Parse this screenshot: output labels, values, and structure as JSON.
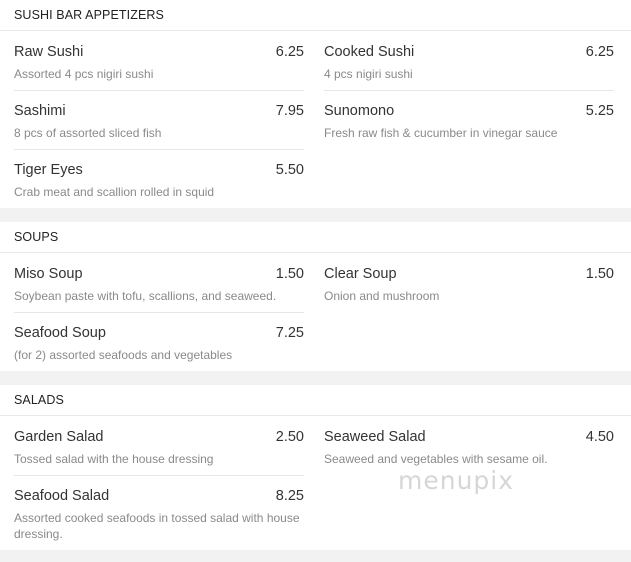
{
  "sections": [
    {
      "title": "SUSHI BAR APPETIZERS",
      "items": [
        {
          "name": "Raw Sushi",
          "price": "6.25",
          "desc": "Assorted 4 pcs nigiri sushi"
        },
        {
          "name": "Cooked Sushi",
          "price": "6.25",
          "desc": "4 pcs nigiri sushi"
        },
        {
          "name": "Sashimi",
          "price": "7.95",
          "desc": "8 pcs of assorted sliced fish"
        },
        {
          "name": "Sunomono",
          "price": "5.25",
          "desc": "Fresh raw fish & cucumber in vinegar sauce"
        },
        {
          "name": "Tiger Eyes",
          "price": "5.50",
          "desc": "Crab meat and scallion rolled in squid"
        }
      ]
    },
    {
      "title": "SOUPS",
      "items": [
        {
          "name": "Miso Soup",
          "price": "1.50",
          "desc": "Soybean paste with tofu, scallions, and seaweed."
        },
        {
          "name": "Clear Soup",
          "price": "1.50",
          "desc": "Onion and mushroom"
        },
        {
          "name": "Seafood Soup",
          "price": "7.25",
          "desc": "(for 2) assorted seafoods and vegetables"
        }
      ]
    },
    {
      "title": "SALADS",
      "items": [
        {
          "name": "Garden Salad",
          "price": "2.50",
          "desc": "Tossed salad with the house dressing"
        },
        {
          "name": "Seaweed Salad",
          "price": "4.50",
          "desc": "Seaweed and vegetables with sesame oil."
        },
        {
          "name": "Seafood Salad",
          "price": "8.25",
          "desc": "Assorted cooked seafoods in tossed salad with house dressing."
        }
      ]
    }
  ],
  "watermark": "menupix"
}
